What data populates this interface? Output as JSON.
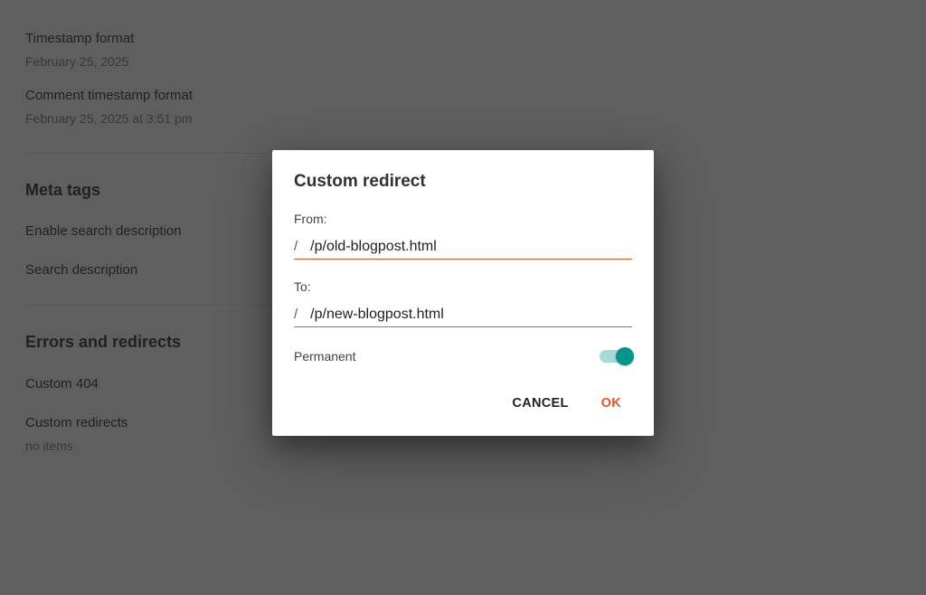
{
  "page": {
    "timestamp_format": {
      "label": "Timestamp format",
      "value": "February 25, 2025"
    },
    "comment_timestamp_format": {
      "label": "Comment timestamp format",
      "value": "February 25, 2025 at 3:51 pm"
    },
    "meta_tags_title": "Meta tags",
    "enable_search_description": "Enable search description",
    "search_description": "Search description",
    "errors_title": "Errors and redirects",
    "custom_404": "Custom 404",
    "custom_redirects": "Custom redirects",
    "no_items": "no items"
  },
  "dialog": {
    "title": "Custom redirect",
    "from_label": "From:",
    "from_prefix": "/",
    "from_value": "/p/old-blogpost.html",
    "to_label": "To:",
    "to_prefix": "/",
    "to_value": "/p/new-blogpost.html",
    "permanent_label": "Permanent",
    "permanent_on": true,
    "cancel": "CANCEL",
    "ok": "OK"
  }
}
